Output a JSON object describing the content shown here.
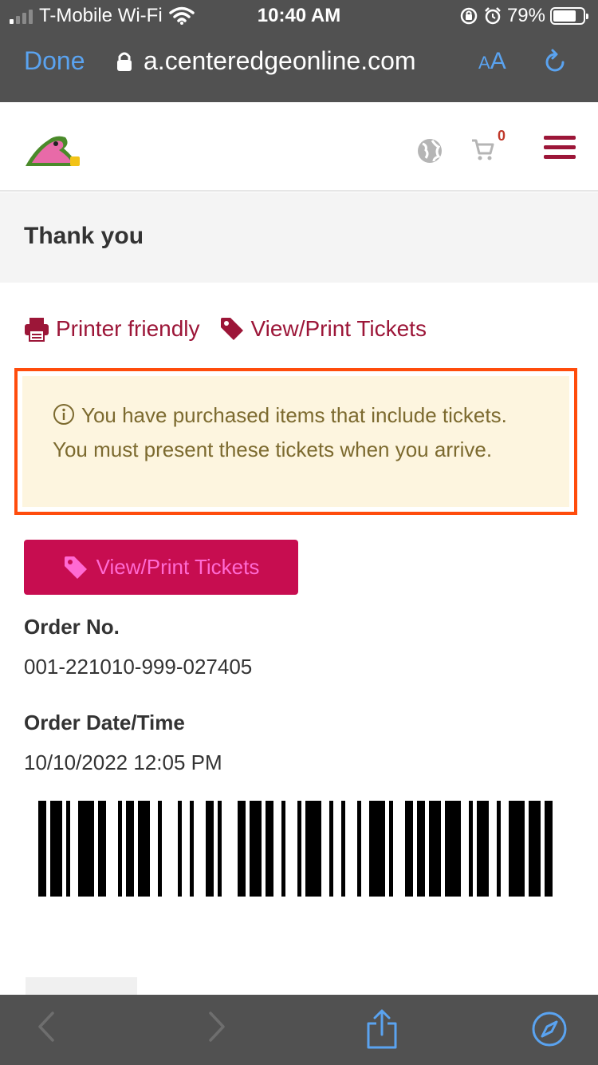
{
  "status_bar": {
    "carrier": "T-Mobile Wi-Fi",
    "time": "10:40 AM",
    "battery_percent": "79%",
    "battery_level": 0.79,
    "signal_bars_active": 1
  },
  "browser": {
    "done_label": "Done",
    "url": "a.centeredgeonline.com",
    "text_size_small": "A",
    "text_size_large": "A"
  },
  "header": {
    "cart_count": "0",
    "accent_color": "#9c1638"
  },
  "page": {
    "title": "Thank you",
    "printer_link": "Printer friendly",
    "tickets_link": "View/Print Tickets",
    "notice": "You have purchased items that include tickets. You must present these tickets when you arrive.",
    "tickets_button": "View/Print Tickets",
    "order_no_label": "Order No.",
    "order_no": "001-221010-999-027405",
    "order_date_label": "Order Date/Time",
    "order_date": "10/10/2022 12:05 PM"
  },
  "icons": {
    "status": [
      "signal-icon",
      "wifi-icon",
      "orientation-lock-icon",
      "alarm-icon",
      "battery-icon"
    ],
    "browser": [
      "lock-icon",
      "reload-icon",
      "back-icon",
      "forward-icon",
      "share-icon",
      "compass-icon"
    ],
    "page": [
      "logo-icon",
      "globe-icon",
      "cart-icon",
      "menu-icon",
      "printer-icon",
      "tag-icon",
      "info-icon",
      "barcode"
    ]
  }
}
